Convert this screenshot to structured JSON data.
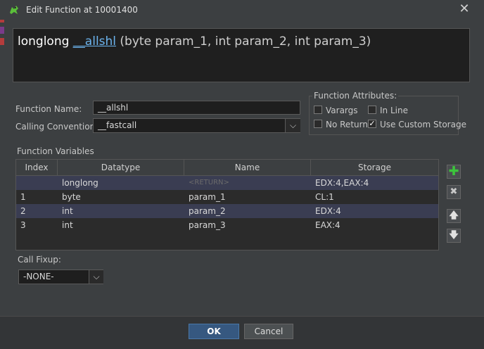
{
  "window": {
    "title": "Edit Function at 10001400"
  },
  "signature": {
    "return_type": "longlong",
    "name": "__allshl",
    "params": " (byte param_1, int param_2, int param_3)"
  },
  "form": {
    "function_name_label": "Function Name:",
    "function_name_value": "__allshl",
    "calling_convention_label": "Calling Convention",
    "calling_convention_value": "__fastcall"
  },
  "attributes": {
    "legend": "Function Attributes:",
    "varargs": {
      "label": "Varargs",
      "checked": false
    },
    "inline": {
      "label": "In Line",
      "checked": false
    },
    "no_return": {
      "label": "No Return",
      "checked": false
    },
    "custom_storage": {
      "label": "Use Custom Storage",
      "checked": true
    }
  },
  "variables": {
    "label": "Function Variables",
    "columns": [
      "Index",
      "Datatype",
      "Name",
      "Storage"
    ],
    "rows": [
      {
        "index": "",
        "datatype": "longlong",
        "name": "<RETURN>",
        "storage": "EDX:4,EAX:4"
      },
      {
        "index": "1",
        "datatype": "byte",
        "name": "param_1",
        "storage": "CL:1"
      },
      {
        "index": "2",
        "datatype": "int",
        "name": "param_2",
        "storage": "EDX:4"
      },
      {
        "index": "3",
        "datatype": "int",
        "name": "param_3",
        "storage": "EAX:4"
      }
    ]
  },
  "side_buttons": {
    "add": "add-icon",
    "remove": "remove-icon",
    "up": "arrow-up-icon",
    "down": "arrow-down-icon"
  },
  "fixup": {
    "label": "Call Fixup:",
    "value": "-NONE-"
  },
  "buttons": {
    "ok": "OK",
    "cancel": "Cancel"
  },
  "colors": {
    "accent": "#6cb4ee",
    "ok_button": "#365880",
    "selected_row": "#3a3d52",
    "add_green": "#3cc43c"
  }
}
